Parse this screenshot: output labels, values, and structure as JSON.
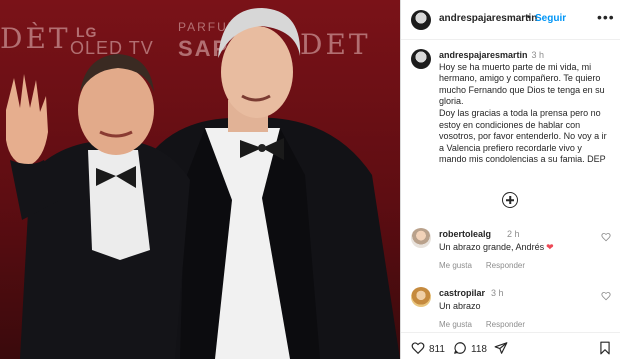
{
  "photo": {
    "backdrop_words": [
      "DÈT",
      "LG",
      "OLED TV",
      "PARFUM",
      "SAPH",
      "DET"
    ],
    "colors": {
      "backdrop": "#6b0f14",
      "suit": "#111114",
      "shirt": "#f4f4f4"
    }
  },
  "header": {
    "username": "andrespajaresmartin",
    "separator": "•",
    "follow_label": "Seguir",
    "more_icon": "more-horizontal-icon"
  },
  "caption": {
    "username": "andrespajaresmartin",
    "time": "3 h",
    "lines": [
      "Hoy se ha muerto parte de mi vida, mi",
      "hermano, amigo y compañero. Te quiero",
      "mucho Fernando que Dios te tenga en su",
      "gloria.",
      "Doy las gracias a toda la prensa pero no",
      "estoy en condiciones de hablar con",
      "vosotros, por favor entenderlo. No voy a ir",
      "a Valencia prefiero recordarle vivo y",
      "mando mis condolencias a su famia. DEP"
    ]
  },
  "load_more_icon": "plus-circle-icon",
  "comments": [
    {
      "username": "robertolealg",
      "time": "2 h",
      "text": "Un abrazo grande, Andrés",
      "emoji": "❤",
      "like_label": "Me gusta",
      "reply_label": "Responder"
    },
    {
      "username": "castropilar",
      "time": "3 h",
      "text": "Un abrazo",
      "like_label": "Me gusta",
      "reply_label": "Responder"
    }
  ],
  "actions": {
    "like_count": "811",
    "comment_count": "118",
    "icons": [
      "heart-icon",
      "comment-icon",
      "share-icon",
      "bookmark-icon"
    ]
  },
  "colors": {
    "link_blue": "#0095f6",
    "muted": "#8e8e8e",
    "heart_red": "#ed4956",
    "text": "#262626"
  }
}
